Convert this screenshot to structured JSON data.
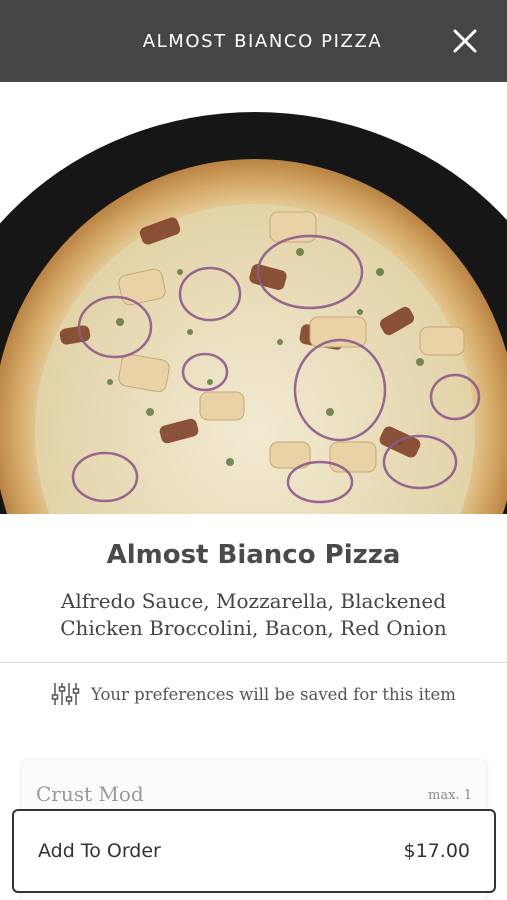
{
  "header": {
    "title": "ALMOST BIANCO PIZZA"
  },
  "item": {
    "name": "Almost Bianco Pizza",
    "description": "Alfredo Sauce, Mozzarella, Blackened Chicken Broccolini, Bacon, Red Onion"
  },
  "preferences": {
    "text": "Your preferences will be saved for this item"
  },
  "modifier_group": {
    "title": "Crust Mod",
    "limit": "max. 1"
  },
  "order": {
    "label": "Add To Order",
    "price": "$17.00"
  },
  "icons": [
    "close-icon",
    "sliders-icon"
  ],
  "colors": {
    "header_bg": "#444546",
    "text": "#333333"
  }
}
